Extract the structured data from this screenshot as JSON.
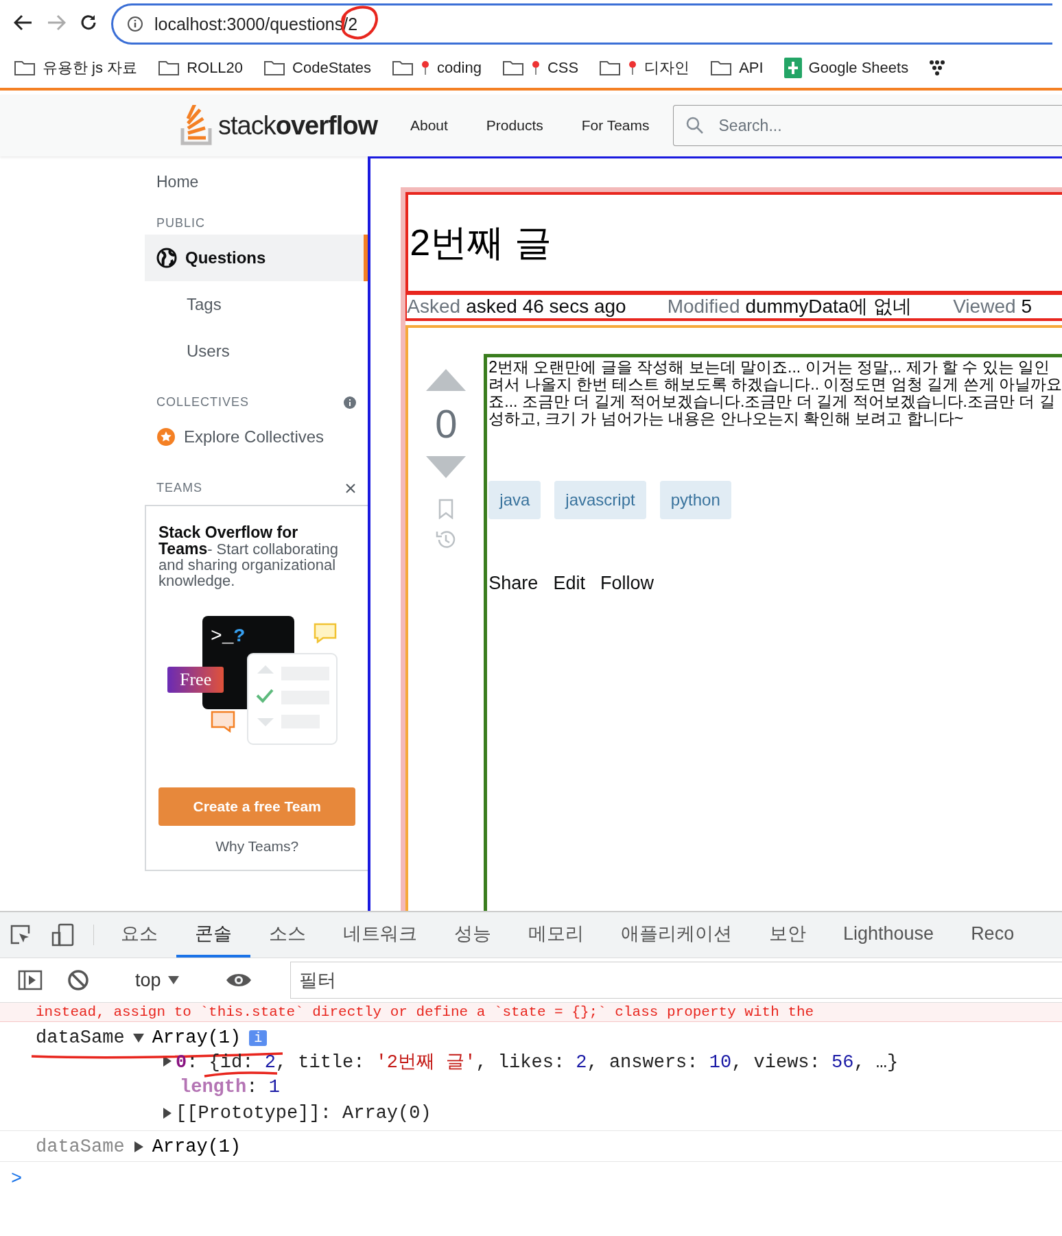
{
  "browser": {
    "url": "localhost:3000/questions/2",
    "bookmarks": [
      {
        "label": "유용한 js 자료",
        "kind": "folder"
      },
      {
        "label": "ROLL20",
        "kind": "folder"
      },
      {
        "label": "CodeStates",
        "kind": "folder"
      },
      {
        "label": "coding",
        "kind": "pin"
      },
      {
        "label": "CSS",
        "kind": "pin"
      },
      {
        "label": "디자인",
        "kind": "pin"
      },
      {
        "label": "API",
        "kind": "folder"
      },
      {
        "label": "Google Sheets",
        "kind": "sheets"
      }
    ]
  },
  "header": {
    "logo": {
      "light": "stack",
      "bold": "overflow"
    },
    "nav": [
      "About",
      "Products",
      "For Teams"
    ],
    "search": {
      "placeholder": "Search..."
    }
  },
  "sidebar": {
    "home": "Home",
    "sections": [
      {
        "heading": "PUBLIC",
        "items": [
          {
            "label": "Questions",
            "selected": true
          },
          {
            "label": "Tags",
            "selected": false
          },
          {
            "label": "Users",
            "selected": false
          }
        ]
      },
      {
        "heading": "COLLECTIVES",
        "items": [
          {
            "label": "Explore Collectives",
            "selected": false
          }
        ]
      }
    ],
    "teams": {
      "heading": "TEAMS",
      "title": "Stack Overflow for Teams",
      "text": "- Start collaborating and sharing organizational knowledge.",
      "badge": "Free",
      "prompt": ">_",
      "mark": "?",
      "button": "Create a free Team",
      "link": "Why Teams?"
    }
  },
  "question": {
    "title": "2번째 글",
    "meta": [
      {
        "label": "Asked",
        "value": "asked 46 secs ago"
      },
      {
        "label": "Modified",
        "value": "dummyData에 없네"
      },
      {
        "label": "Viewed",
        "value": "5"
      }
    ],
    "votes": "0",
    "body_lines": [
      "2번재 오랜만에 글을 작성해 보는데 말이죠... 이거는 정말,.. 제가 할 수 있는 일인",
      "려서 나올지 한번 테스트 해보도록 하겠습니다.. 이정도면 엄청 길게 쓴게 아닐까요",
      "죠... 조금만 더 길게 적어보겠습니다.조금만 더 길게 적어보겠습니다.조금만 더 길",
      "성하고, 크기 가 넘어가는 내용은 안나오는지 확인해 보려고 합니다~"
    ],
    "tags": [
      "java",
      "javascript",
      "python"
    ],
    "actions": [
      "Share",
      "Edit",
      "Follow"
    ]
  },
  "devtools": {
    "tabs": [
      {
        "label": "요소",
        "selected": false
      },
      {
        "label": "콘솔",
        "selected": true
      },
      {
        "label": "소스",
        "selected": false
      },
      {
        "label": "네트워크",
        "selected": false
      },
      {
        "label": "성능",
        "selected": false
      },
      {
        "label": "메모리",
        "selected": false
      },
      {
        "label": "애플리케이션",
        "selected": false
      },
      {
        "label": "보안",
        "selected": false
      },
      {
        "label": "Lighthouse",
        "selected": false
      },
      {
        "label": "Reco",
        "selected": false
      }
    ],
    "context": "top",
    "filter": {
      "placeholder": "필터"
    },
    "error_line": "instead, assign to `this.state` directly or define a `state = {};` class property with the",
    "entries": [
      {
        "label": "dataSame",
        "summary": "Array(1)",
        "expanded": true,
        "badge": "i",
        "children": [
          {
            "expandable": true,
            "tokens": [
              {
                "text": "0",
                "kind": "index"
              },
              {
                "text": ": {",
                "kind": "plain"
              },
              {
                "text": "id",
                "kind": "plain"
              },
              {
                "text": ": ",
                "kind": "plain"
              },
              {
                "text": "2",
                "kind": "number"
              },
              {
                "text": ", title: ",
                "kind": "plain"
              },
              {
                "text": "'2번째 글'",
                "kind": "string"
              },
              {
                "text": ", likes: ",
                "kind": "plain"
              },
              {
                "text": "2",
                "kind": "number"
              },
              {
                "text": ", answers: ",
                "kind": "plain"
              },
              {
                "text": "10",
                "kind": "number"
              },
              {
                "text": ", views: ",
                "kind": "plain"
              },
              {
                "text": "56",
                "kind": "number"
              },
              {
                "text": ", …}",
                "kind": "plain"
              }
            ]
          },
          {
            "expandable": false,
            "tokens": [
              {
                "text": "length",
                "kind": "meta"
              },
              {
                "text": ": ",
                "kind": "plain"
              },
              {
                "text": "1",
                "kind": "number"
              }
            ]
          },
          {
            "expandable": true,
            "tokens": [
              {
                "text": "[[Prototype]]",
                "kind": "plain"
              },
              {
                "text": ": Array(0)",
                "kind": "plain"
              }
            ]
          }
        ]
      },
      {
        "label": "dataSame",
        "summary": "Array(1)",
        "expanded": false
      }
    ],
    "prompt": ">"
  }
}
